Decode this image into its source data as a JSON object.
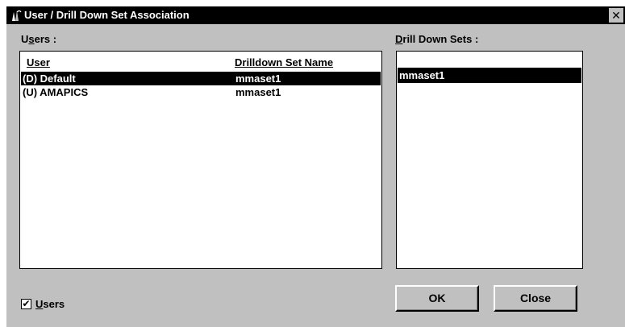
{
  "window": {
    "title": "User / Drill Down Set Association",
    "close_glyph": "✕"
  },
  "users_group": {
    "label_prefix": "U",
    "label_underlined": "s",
    "label_rest": "ers :",
    "columns": [
      "User",
      "Drilldown Set Name"
    ],
    "rows": [
      {
        "user": "(D) Default",
        "set": "mmaset1",
        "selected": true
      },
      {
        "user": "(U) AMAPICS",
        "set": "mmaset1",
        "selected": false
      }
    ]
  },
  "drill_group": {
    "label_underlined": "D",
    "label_rest": "rill Down Sets :",
    "items": [
      {
        "label": "",
        "selected": false
      },
      {
        "label": "mmaset1",
        "selected": true
      }
    ]
  },
  "users_checkbox": {
    "checked": true,
    "check_glyph": "✔",
    "label_underlined": "U",
    "label_rest": "sers"
  },
  "buttons": {
    "ok": "OK",
    "close": "Close"
  },
  "icons": {
    "app": "app-logo-icon",
    "close": "close-icon"
  }
}
